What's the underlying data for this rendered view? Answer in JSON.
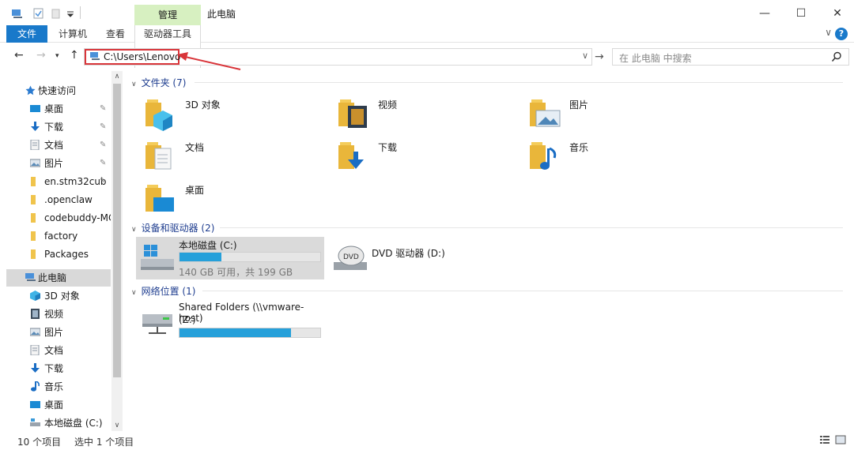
{
  "titlebar": {
    "manage_tab": "管理",
    "window_title": "此电脑",
    "minimize": "—",
    "maximize": "☐",
    "close": "✕"
  },
  "ribbon": {
    "tabs": [
      {
        "label": "文件"
      },
      {
        "label": "计算机"
      },
      {
        "label": "查看"
      },
      {
        "label": "驱动器工具"
      }
    ],
    "help": "?",
    "collapse": "∨"
  },
  "address": {
    "path": "C:\\Users\\Lenovo",
    "search_placeholder": "在 此电脑 中搜索"
  },
  "nav": {
    "items": [
      {
        "label": "快速访问",
        "icon": "star-icon",
        "pinned": false
      },
      {
        "label": "桌面",
        "icon": "desktop-icon",
        "pinned": true
      },
      {
        "label": "下载",
        "icon": "download-icon",
        "pinned": true
      },
      {
        "label": "文档",
        "icon": "document-icon",
        "pinned": true
      },
      {
        "label": "图片",
        "icon": "picture-icon",
        "pinned": true
      },
      {
        "label": "en.stm32cub",
        "icon": "folder-icon",
        "pinned": true
      },
      {
        "label": ".openclaw",
        "icon": "folder-icon",
        "pinned": false
      },
      {
        "label": "codebuddy-MC",
        "icon": "folder-icon",
        "pinned": false
      },
      {
        "label": "factory",
        "icon": "folder-icon",
        "pinned": false
      },
      {
        "label": "Packages",
        "icon": "folder-icon",
        "pinned": false
      },
      {
        "label": "此电脑",
        "icon": "computer-icon",
        "pinned": false
      },
      {
        "label": "3D 对象",
        "icon": "3d-objects-icon",
        "pinned": false
      },
      {
        "label": "视频",
        "icon": "video-icon",
        "pinned": false
      },
      {
        "label": "图片",
        "icon": "picture-icon",
        "pinned": false
      },
      {
        "label": "文档",
        "icon": "document-icon",
        "pinned": false
      },
      {
        "label": "下载",
        "icon": "download-icon",
        "pinned": false
      },
      {
        "label": "音乐",
        "icon": "music-icon",
        "pinned": false
      },
      {
        "label": "桌面",
        "icon": "desktop-icon",
        "pinned": false
      },
      {
        "label": "本地磁盘 (C:)",
        "icon": "drive-icon",
        "pinned": false
      }
    ],
    "pin_glyph": "📌"
  },
  "content": {
    "folders_header": "文件夹 (7)",
    "folders": [
      {
        "label": "3D 对象",
        "icon": "3d-objects-icon"
      },
      {
        "label": "视频",
        "icon": "video-icon"
      },
      {
        "label": "图片",
        "icon": "picture-icon"
      },
      {
        "label": "文档",
        "icon": "document-icon"
      },
      {
        "label": "下载",
        "icon": "download-icon"
      },
      {
        "label": "音乐",
        "icon": "music-icon"
      },
      {
        "label": "桌面",
        "icon": "desktop-icon"
      }
    ],
    "devices_header": "设备和驱动器 (2)",
    "drives": [
      {
        "label": "本地磁盘 (C:)",
        "subtitle": "140 GB 可用，共 199 GB",
        "used_fraction": 0.296
      },
      {
        "label": "DVD 驱动器 (D:)"
      }
    ],
    "network_header": "网络位置 (1)",
    "network": [
      {
        "label_line1": "Shared Folders (\\\\vmware-host)",
        "label_line2": "(Z:)",
        "used_fraction": 0.79
      }
    ]
  },
  "status": {
    "item_count": "10 个项目",
    "selected": "选中 1 个项目"
  },
  "colors": {
    "accent": "#1979ca",
    "manage_tab": "#d7f0c1",
    "bar_fill": "#26a0da",
    "annotation_red": "#d9353a"
  }
}
